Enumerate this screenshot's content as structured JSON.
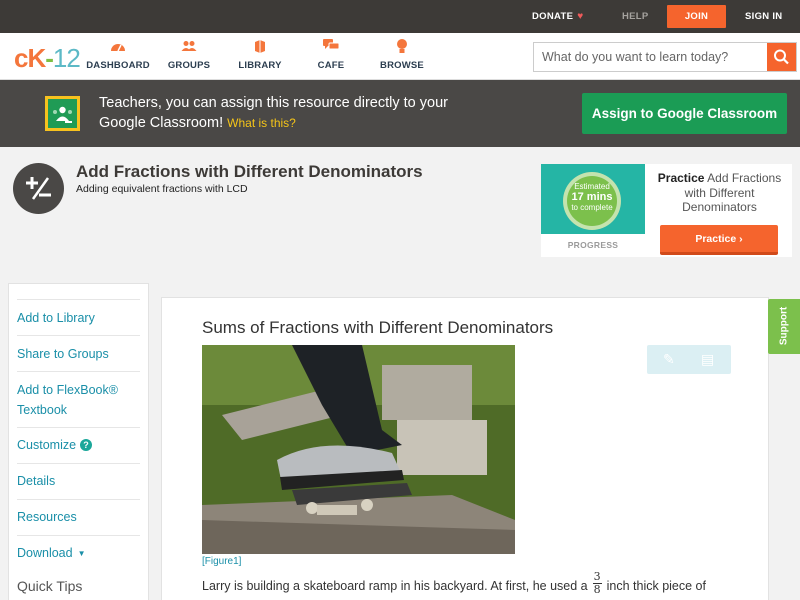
{
  "topbar": {
    "donate": "DONATE",
    "help": "HELP",
    "join": "JOIN",
    "signin": "SIGN IN"
  },
  "nav": {
    "logo": {
      "ck": "cK",
      "dash": "-",
      "num": "12"
    },
    "items": [
      {
        "label": "DASHBOARD",
        "icon": "dashboard-icon"
      },
      {
        "label": "GROUPS",
        "icon": "groups-icon"
      },
      {
        "label": "LIBRARY",
        "icon": "library-icon"
      },
      {
        "label": "CAFE",
        "icon": "cafe-icon"
      },
      {
        "label": "BROWSE",
        "icon": "browse-icon"
      }
    ],
    "search_placeholder": "What do you want to learn today?"
  },
  "banner": {
    "text": "Teachers, you can assign this resource directly to your Google Classroom!",
    "what_link": "What is this?",
    "button": "Assign to Google Classroom"
  },
  "concept": {
    "title": "Add Fractions with Different Denominators",
    "subtitle": "Adding equivalent fractions with LCD"
  },
  "practice": {
    "estimated": "Estimated",
    "mins": "17 mins",
    "to_complete": "to complete",
    "progress_label": "PROGRESS",
    "title_bold": "Practice",
    "title_rest": "Add Fractions with Different Denominators",
    "button": "Practice"
  },
  "sidebar": {
    "items": [
      {
        "label": "Add to Library"
      },
      {
        "label": "Share to Groups"
      },
      {
        "label": "Add to FlexBook® Textbook"
      },
      {
        "label": "Customize"
      },
      {
        "label": "Details"
      },
      {
        "label": "Resources"
      },
      {
        "label": "Download"
      }
    ],
    "quick_tips": "Quick Tips"
  },
  "content": {
    "title": "Sums of Fractions with Different Denominators",
    "figure_caption": "[Figure1]",
    "body_before": "Larry is building a skateboard ramp in his backyard. At first, he used a",
    "frac_num": "3",
    "frac_den": "8",
    "body_after": "inch thick piece of"
  },
  "support_tab": "Support",
  "colors": {
    "brand_orange": "#f5642d",
    "classroom_green": "#1b9c55",
    "link_teal": "#1a8fa8",
    "support_green": "#7cc04c"
  }
}
